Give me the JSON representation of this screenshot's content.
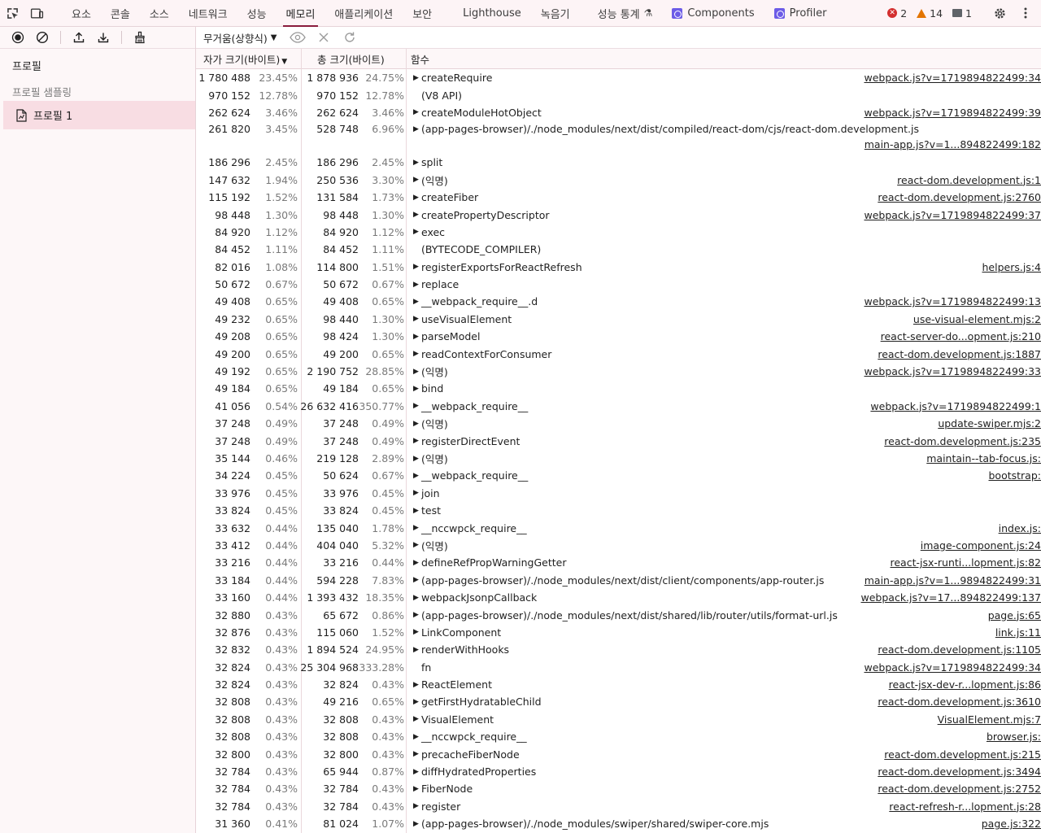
{
  "tabs": [
    "요소",
    "콘솔",
    "소스",
    "네트워크",
    "성능",
    "메모리",
    "애플리케이션",
    "보안",
    "Lighthouse",
    "녹음기",
    "성능 통계",
    "Components",
    "Profiler"
  ],
  "active_tab": "메모리",
  "counts": {
    "errors": "2",
    "warnings": "14",
    "messages": "1"
  },
  "left": {
    "heading": "프로필",
    "sub": "프로필 샘플링",
    "profile": "프로필 1"
  },
  "toolbar": {
    "sort": "무거움(상향식)"
  },
  "columns": {
    "self": "자가 크기(바이트)",
    "total": "총 크기(바이트)",
    "fn": "함수"
  },
  "rows": [
    {
      "s": "1 780 488",
      "sp": "23.45%",
      "t": "1 878 936",
      "tp": "24.75%",
      "f": "createRequire",
      "u": "webpack.js?v=1719894822499:34",
      "e": true
    },
    {
      "s": "970 152",
      "sp": "12.78%",
      "t": "970 152",
      "tp": "12.78%",
      "f": "(V8 API)",
      "u": "",
      "e": false
    },
    {
      "s": "262 624",
      "sp": "3.46%",
      "t": "262 624",
      "tp": "3.46%",
      "f": "createModuleHotObject",
      "u": "webpack.js?v=1719894822499:39",
      "e": true
    },
    {
      "s": "261 820",
      "sp": "3.45%",
      "t": "528 748",
      "tp": "6.96%",
      "f": "(app-pages-browser)/./node_modules/next/dist/compiled/react-dom/cjs/react-dom.development.js",
      "u": "main-app.js?v=1...894822499:182",
      "e": true,
      "tall": true
    },
    {
      "s": "186 296",
      "sp": "2.45%",
      "t": "186 296",
      "tp": "2.45%",
      "f": "split",
      "u": "",
      "e": true
    },
    {
      "s": "147 632",
      "sp": "1.94%",
      "t": "250 536",
      "tp": "3.30%",
      "f": "(익명)",
      "u": "react-dom.development.js:1",
      "e": true
    },
    {
      "s": "115 192",
      "sp": "1.52%",
      "t": "131 584",
      "tp": "1.73%",
      "f": "createFiber",
      "u": "react-dom.development.js:2760",
      "e": true
    },
    {
      "s": "98 448",
      "sp": "1.30%",
      "t": "98 448",
      "tp": "1.30%",
      "f": "createPropertyDescriptor",
      "u": "webpack.js?v=1719894822499:37",
      "e": true
    },
    {
      "s": "84 920",
      "sp": "1.12%",
      "t": "84 920",
      "tp": "1.12%",
      "f": "exec",
      "u": "",
      "e": true
    },
    {
      "s": "84 452",
      "sp": "1.11%",
      "t": "84 452",
      "tp": "1.11%",
      "f": "(BYTECODE_COMPILER)",
      "u": "",
      "e": false
    },
    {
      "s": "82 016",
      "sp": "1.08%",
      "t": "114 800",
      "tp": "1.51%",
      "f": "registerExportsForReactRefresh",
      "u": "helpers.js:4",
      "e": true
    },
    {
      "s": "50 672",
      "sp": "0.67%",
      "t": "50 672",
      "tp": "0.67%",
      "f": "replace",
      "u": "",
      "e": true
    },
    {
      "s": "49 408",
      "sp": "0.65%",
      "t": "49 408",
      "tp": "0.65%",
      "f": "__webpack_require__.d",
      "u": "webpack.js?v=1719894822499:13",
      "e": true
    },
    {
      "s": "49 232",
      "sp": "0.65%",
      "t": "98 440",
      "tp": "1.30%",
      "f": "useVisualElement",
      "u": "use-visual-element.mjs:2",
      "e": true
    },
    {
      "s": "49 208",
      "sp": "0.65%",
      "t": "98 424",
      "tp": "1.30%",
      "f": "parseModel",
      "u": "react-server-do...opment.js:210",
      "e": true
    },
    {
      "s": "49 200",
      "sp": "0.65%",
      "t": "49 200",
      "tp": "0.65%",
      "f": "readContextForConsumer",
      "u": "react-dom.development.js:1887",
      "e": true
    },
    {
      "s": "49 192",
      "sp": "0.65%",
      "t": "2 190 752",
      "tp": "28.85%",
      "f": "(익명)",
      "u": "webpack.js?v=1719894822499:33",
      "e": true
    },
    {
      "s": "49 184",
      "sp": "0.65%",
      "t": "49 184",
      "tp": "0.65%",
      "f": "bind",
      "u": "",
      "e": true
    },
    {
      "s": "41 056",
      "sp": "0.54%",
      "t": "26 632 416",
      "tp": "350.77%",
      "f": "__webpack_require__",
      "u": "webpack.js?v=1719894822499:1",
      "e": true
    },
    {
      "s": "37 248",
      "sp": "0.49%",
      "t": "37 248",
      "tp": "0.49%",
      "f": "(익명)",
      "u": "update-swiper.mjs:2",
      "e": true
    },
    {
      "s": "37 248",
      "sp": "0.49%",
      "t": "37 248",
      "tp": "0.49%",
      "f": "registerDirectEvent",
      "u": "react-dom.development.js:235",
      "e": true
    },
    {
      "s": "35 144",
      "sp": "0.46%",
      "t": "219 128",
      "tp": "2.89%",
      "f": "(익명)",
      "u": "maintain--tab-focus.js:",
      "e": true
    },
    {
      "s": "34 224",
      "sp": "0.45%",
      "t": "50 624",
      "tp": "0.67%",
      "f": "__webpack_require__",
      "u": "bootstrap:",
      "e": true
    },
    {
      "s": "33 976",
      "sp": "0.45%",
      "t": "33 976",
      "tp": "0.45%",
      "f": "join",
      "u": "",
      "e": true
    },
    {
      "s": "33 824",
      "sp": "0.45%",
      "t": "33 824",
      "tp": "0.45%",
      "f": "test",
      "u": "",
      "e": true
    },
    {
      "s": "33 632",
      "sp": "0.44%",
      "t": "135 040",
      "tp": "1.78%",
      "f": "__nccwpck_require__",
      "u": "index.js:",
      "e": true
    },
    {
      "s": "33 412",
      "sp": "0.44%",
      "t": "404 040",
      "tp": "5.32%",
      "f": "(익명)",
      "u": "image-component.js:24",
      "e": true
    },
    {
      "s": "33 216",
      "sp": "0.44%",
      "t": "33 216",
      "tp": "0.44%",
      "f": "defineRefPropWarningGetter",
      "u": "react-jsx-runti...lopment.js:82",
      "e": true
    },
    {
      "s": "33 184",
      "sp": "0.44%",
      "t": "594 228",
      "tp": "7.83%",
      "f": "(app-pages-browser)/./node_modules/next/dist/client/components/app-router.js",
      "u": "main-app.js?v=1...9894822499:31",
      "e": true
    },
    {
      "s": "33 160",
      "sp": "0.44%",
      "t": "1 393 432",
      "tp": "18.35%",
      "f": "webpackJsonpCallback",
      "u": "webpack.js?v=17...894822499:137",
      "e": true
    },
    {
      "s": "32 880",
      "sp": "0.43%",
      "t": "65 672",
      "tp": "0.86%",
      "f": "(app-pages-browser)/./node_modules/next/dist/shared/lib/router/utils/format-url.js",
      "u": "page.js:65",
      "e": true
    },
    {
      "s": "32 876",
      "sp": "0.43%",
      "t": "115 060",
      "tp": "1.52%",
      "f": "LinkComponent",
      "u": "link.js:11",
      "e": true
    },
    {
      "s": "32 832",
      "sp": "0.43%",
      "t": "1 894 524",
      "tp": "24.95%",
      "f": "renderWithHooks",
      "u": "react-dom.development.js:1105",
      "e": true
    },
    {
      "s": "32 824",
      "sp": "0.43%",
      "t": "25 304 968",
      "tp": "333.28%",
      "f": "fn",
      "u": "webpack.js?v=1719894822499:34",
      "e": false
    },
    {
      "s": "32 824",
      "sp": "0.43%",
      "t": "32 824",
      "tp": "0.43%",
      "f": "ReactElement",
      "u": "react-jsx-dev-r...lopment.js:86",
      "e": true
    },
    {
      "s": "32 808",
      "sp": "0.43%",
      "t": "49 216",
      "tp": "0.65%",
      "f": "getFirstHydratableChild",
      "u": "react-dom.development.js:3610",
      "e": true
    },
    {
      "s": "32 808",
      "sp": "0.43%",
      "t": "32 808",
      "tp": "0.43%",
      "f": "VisualElement",
      "u": "VisualElement.mjs:7",
      "e": true
    },
    {
      "s": "32 808",
      "sp": "0.43%",
      "t": "32 808",
      "tp": "0.43%",
      "f": "__nccwpck_require__",
      "u": "browser.js:",
      "e": true
    },
    {
      "s": "32 800",
      "sp": "0.43%",
      "t": "32 800",
      "tp": "0.43%",
      "f": "precacheFiberNode",
      "u": "react-dom.development.js:215",
      "e": true
    },
    {
      "s": "32 784",
      "sp": "0.43%",
      "t": "65 944",
      "tp": "0.87%",
      "f": "diffHydratedProperties",
      "u": "react-dom.development.js:3494",
      "e": true
    },
    {
      "s": "32 784",
      "sp": "0.43%",
      "t": "32 784",
      "tp": "0.43%",
      "f": "FiberNode",
      "u": "react-dom.development.js:2752",
      "e": true
    },
    {
      "s": "32 784",
      "sp": "0.43%",
      "t": "32 784",
      "tp": "0.43%",
      "f": "register",
      "u": "react-refresh-r...lopment.js:28",
      "e": true
    },
    {
      "s": "31 360",
      "sp": "0.41%",
      "t": "81 024",
      "tp": "1.07%",
      "f": "(app-pages-browser)/./node_modules/swiper/shared/swiper-core.mjs",
      "u": "page.js:322",
      "e": true
    }
  ]
}
